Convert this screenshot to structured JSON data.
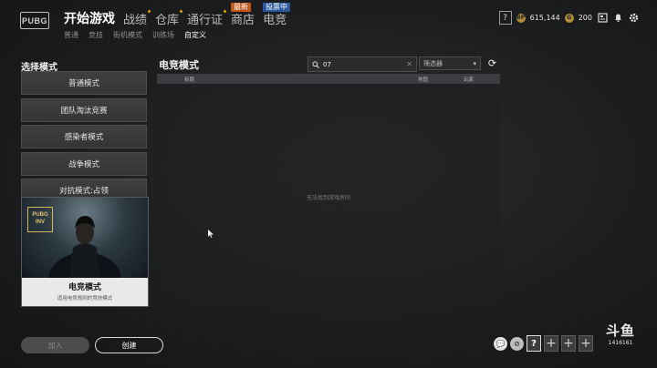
{
  "logo": "PUBG",
  "nav": {
    "items": [
      {
        "label": "开始游戏",
        "active": true
      },
      {
        "label": "战绩",
        "dot": true
      },
      {
        "label": "仓库",
        "dot": true
      },
      {
        "label": "通行证",
        "dot": true
      },
      {
        "label": "商店",
        "badge": "最新"
      },
      {
        "label": "电竞",
        "badge": "投票中"
      }
    ]
  },
  "subnav": [
    "普通",
    "竞技",
    "街机模式",
    "训练场",
    "自定义"
  ],
  "hud": {
    "help": "?",
    "bp": "615,144",
    "g_coin": "200"
  },
  "left": {
    "title": "选择模式",
    "modes": [
      "普通模式",
      "团队淘汰竞赛",
      "感染者模式",
      "战争模式",
      "对抗模式:占领"
    ],
    "feature": {
      "title": "电竞模式",
      "subtitle": "适用电竞规则的竞技模式",
      "logo_text": "PUBG INVITATIONAL"
    }
  },
  "main": {
    "title": "电竞模式",
    "search_value": "07",
    "filter_placeholder": "筛选器",
    "columns": [
      "标题",
      "地图",
      "玩家"
    ],
    "empty_text": "无法找到游戏房间"
  },
  "bottom": {
    "join": "加入",
    "create": "创建"
  },
  "watermark": {
    "brand": "斗鱼",
    "id": "1416161"
  }
}
